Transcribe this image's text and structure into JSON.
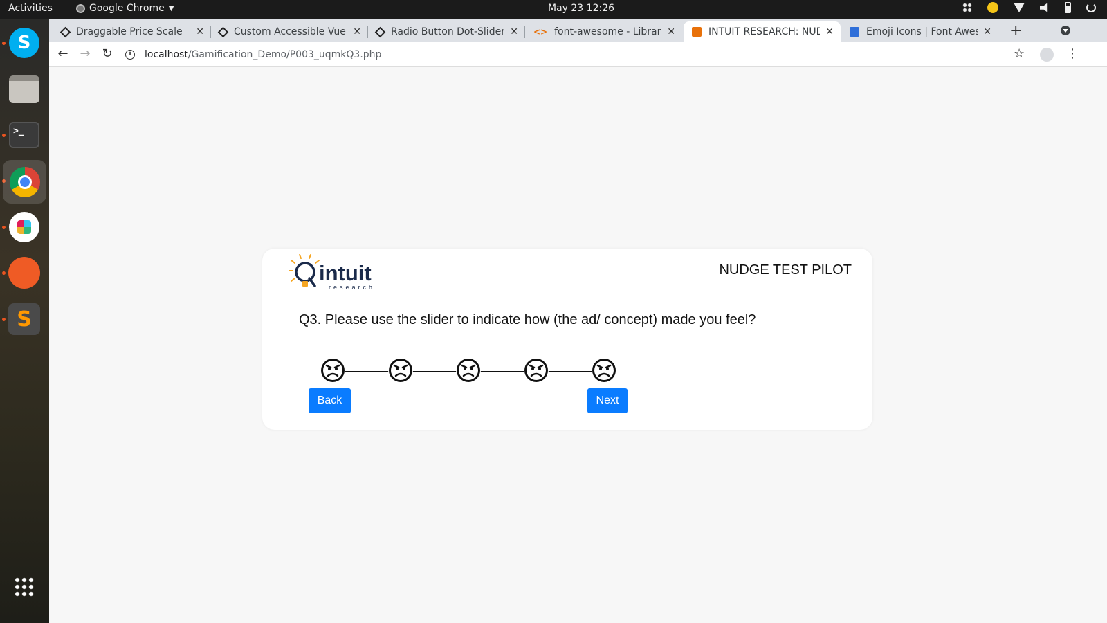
{
  "system_bar": {
    "activities": "Activities",
    "app_name": "Google Chrome",
    "clock": "May 23  12:26"
  },
  "browser": {
    "tabs": [
      {
        "title": "Draggable Price Scale",
        "favicon": "codepen-icon",
        "active": false
      },
      {
        "title": "Custom Accessible Vue E",
        "favicon": "codepen-icon",
        "active": false
      },
      {
        "title": "Radio Button Dot-Slider",
        "favicon": "codepen-icon",
        "active": false
      },
      {
        "title": "font-awesome - Libraries",
        "favicon": "cdn-code-icon",
        "active": false
      },
      {
        "title": "INTUIT RESEARCH: NUDG",
        "favicon": "intuit-favicon",
        "active": true
      },
      {
        "title": "Emoji Icons | Font Aweso",
        "favicon": "fontawesome-flag-icon",
        "active": false
      }
    ],
    "url_host": "localhost",
    "url_path": "/Gamification_Demo/P003_uqmkQ3.php"
  },
  "survey": {
    "logo_word": "intuit",
    "logo_sub": "research",
    "header_title": "NUDGE TEST PILOT",
    "question": "Q3. Please use the slider to indicate how (the ad/ concept) made you feel?",
    "scale_faces": [
      "angry-face-icon",
      "angry-face-icon",
      "angry-face-icon",
      "angry-face-icon",
      "angry-face-icon"
    ],
    "back_label": "Back",
    "next_label": "Next",
    "button_color": "#0a7cff"
  }
}
